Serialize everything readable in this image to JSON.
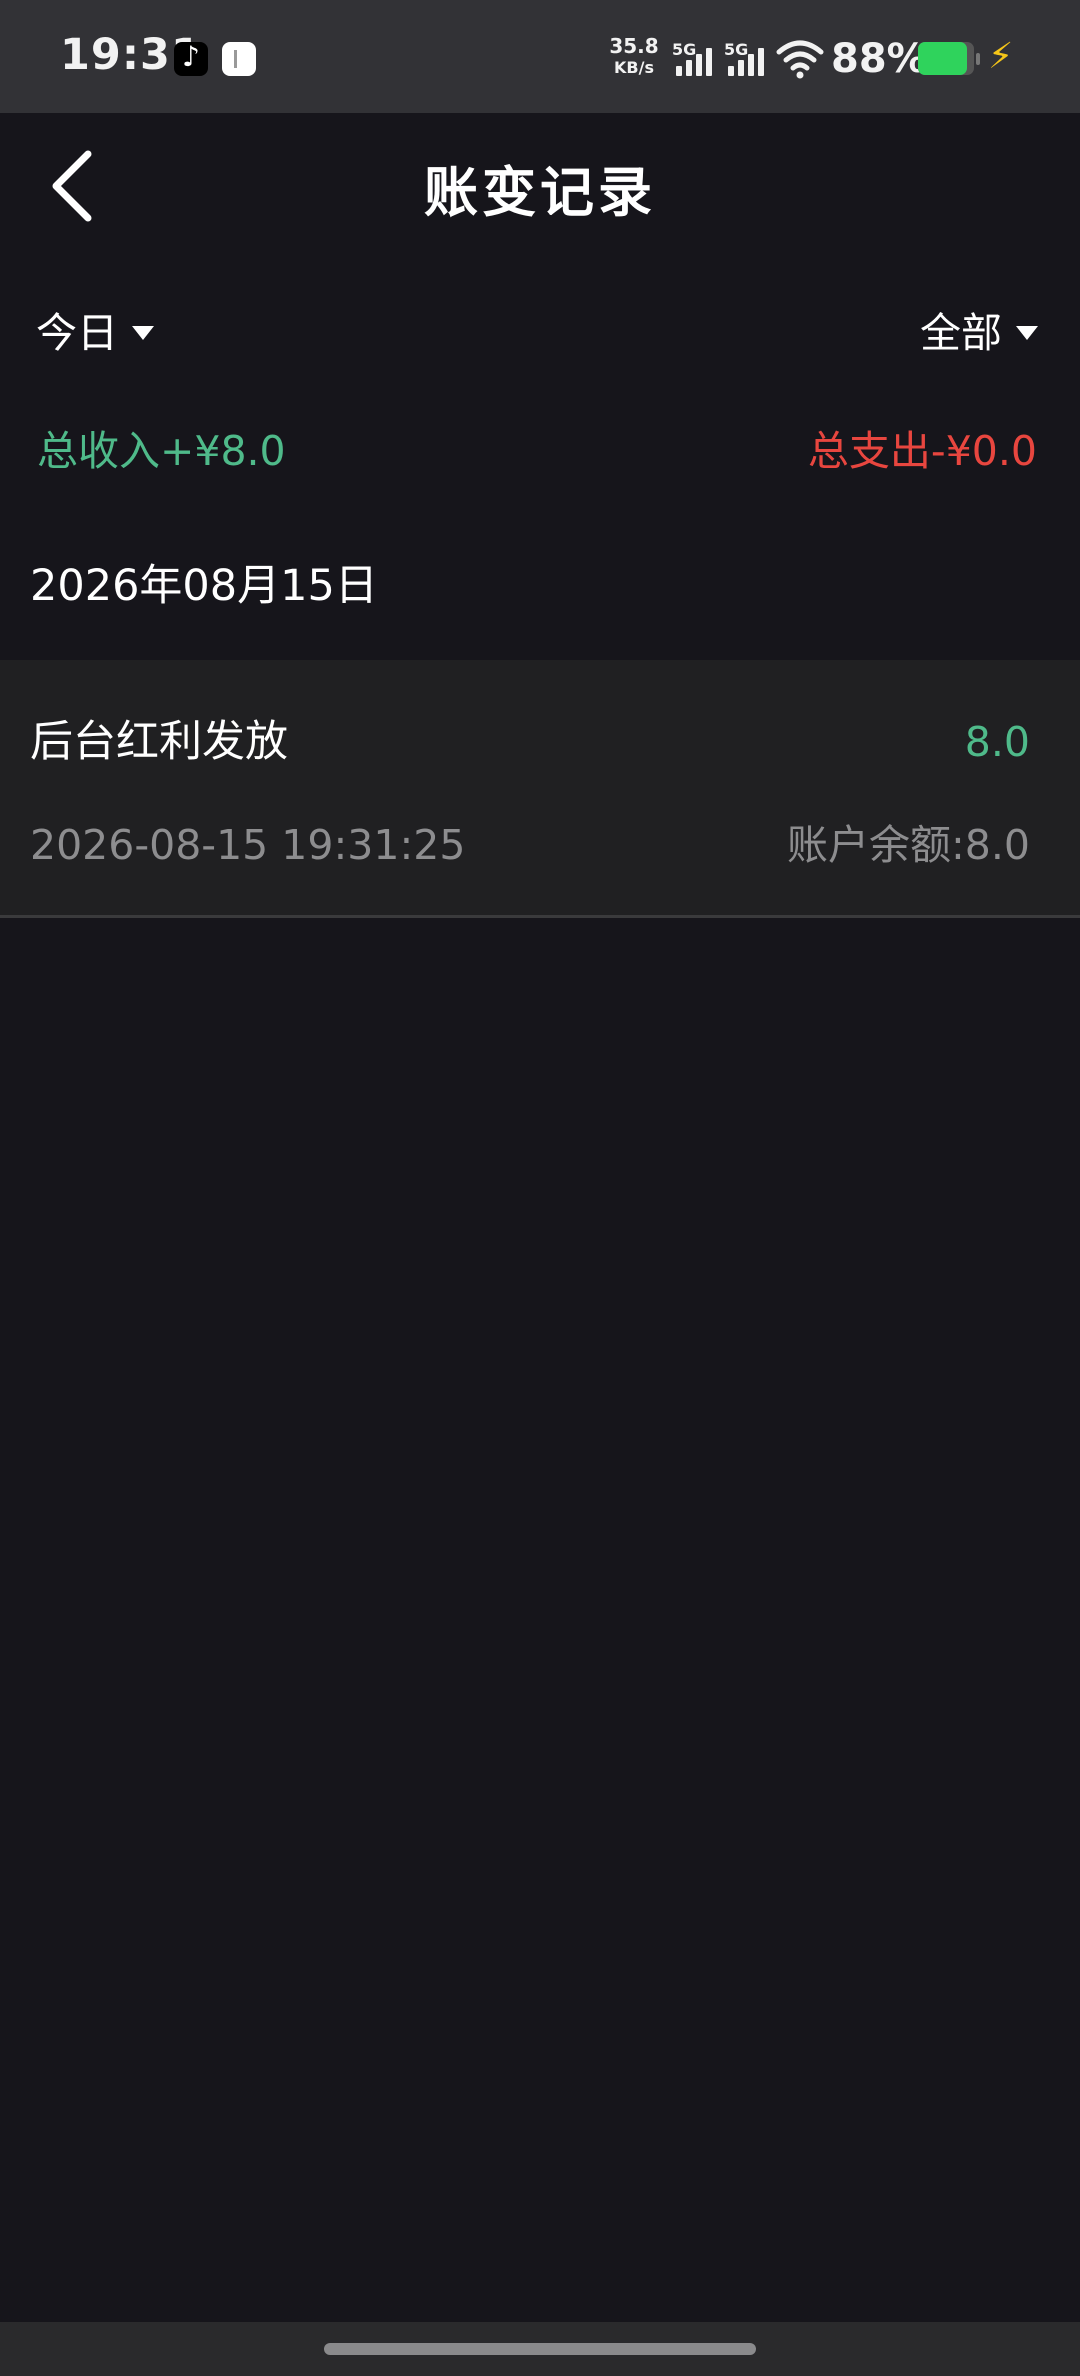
{
  "status_bar": {
    "time": "19:31",
    "net_speed_value": "35.8",
    "net_speed_unit": "KB/s",
    "sim1_tag": "5G",
    "sim2_tag": "5G",
    "battery_percent": "88%",
    "battery_level": 0.88,
    "icons": [
      "tiktok-app-icon",
      "notification-app-icon",
      "signal-icon",
      "wifi-icon",
      "battery-icon",
      "charging-icon"
    ]
  },
  "header": {
    "title": "账变记录",
    "back_icon": "chevron-left-icon"
  },
  "filters": {
    "date_label": "今日",
    "type_label": "全部"
  },
  "summary": {
    "income": "总收入+¥8.0",
    "expense": "总支出-¥0.0",
    "income_color": "#4fba8a",
    "expense_color": "#e8463f"
  },
  "records": {
    "date": "2026年08月15日",
    "items": [
      {
        "title": "后台红利发放",
        "amount": "8.0",
        "time": "2026-08-15 19:31:25",
        "balance": "账户余额:8.0"
      }
    ]
  }
}
